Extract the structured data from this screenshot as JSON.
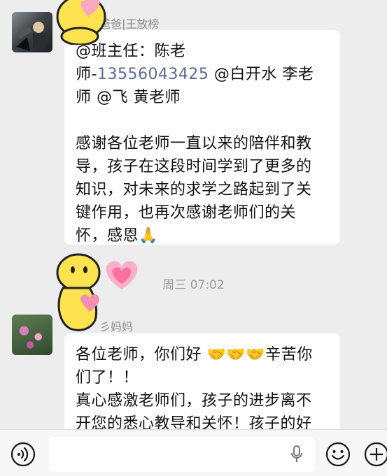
{
  "messages": [
    {
      "sender": "爸爸|王放榜",
      "lines": [
        "@班主任：陈老",
        "师-",
        "13556043425",
        " @白开水  李老",
        "师 @飞  黄老师"
      ],
      "para2": [
        "感谢各位老师一直以来的陪伴和教",
        "导，孩子在这段时间学到了更多的",
        "知识，对未来的求学之路起到了关",
        "键作用，也再次感谢老师们的关",
        "怀，感恩🙏"
      ]
    },
    {
      "sender": "彡妈妈",
      "lines": [
        "各位老师，你们好 ",
        "🤝🤝🤝",
        "辛苦你",
        "们了！！",
        "真心感激老师们，孩子的进步离不",
        "开您的悉心教导和关怀！孩子的好"
      ]
    }
  ],
  "timestamp": "周三 07:02",
  "icons": {
    "voice": "voice-icon",
    "mic": "microphone-icon",
    "emoji": "emoji-icon",
    "plus": "plus-icon"
  },
  "colors": {
    "background": "#ededed",
    "bubble": "#ffffff",
    "link": "#576b95"
  }
}
